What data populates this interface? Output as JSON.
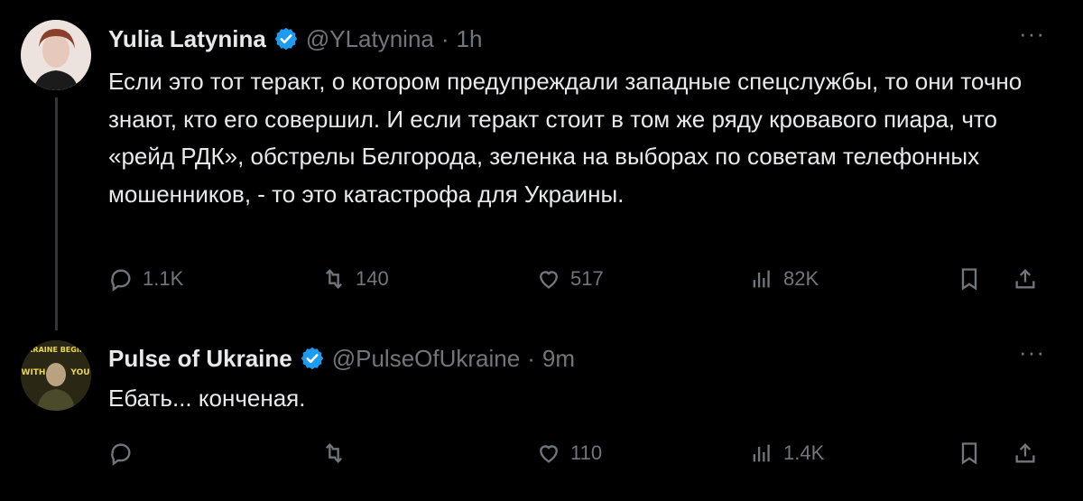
{
  "tweets": [
    {
      "name": "Yulia Latynina",
      "handle": "@YLatynina",
      "separator": "·",
      "time": "1h",
      "more": "···",
      "text": "Если это тот теракт, о котором предупреждали западные спецслужбы, то они точно знают, кто его совершил. И если теракт стоит в том же ряду кровавого пиара, что «рейд РДК», обстрелы Белгорода, зеленка на выборах по советам телефонных мошенников, - то это катастрофа для Украины.",
      "replies": "1.1K",
      "retweets": "140",
      "likes": "517",
      "views": "82K"
    },
    {
      "name": "Pulse of Ukraine",
      "handle": "@PulseOfUkraine",
      "separator": "·",
      "time": "9m",
      "more": "···",
      "text": "Ебать... конченая.",
      "replies": "",
      "retweets": "",
      "likes": "110",
      "views": "1.4K",
      "avatar_text": [
        "UKRAINE BEGINS",
        "WITH",
        "YOU"
      ]
    }
  ],
  "colors": {
    "background": "#000000",
    "text": "#e7e9ea",
    "muted": "#71767b",
    "verified": "#1d9bf0",
    "thread_line": "#333639"
  },
  "icons": [
    "reply-icon",
    "retweet-icon",
    "heart-icon",
    "views-icon",
    "bookmark-icon",
    "share-icon",
    "verified-badge-icon",
    "more-icon"
  ]
}
